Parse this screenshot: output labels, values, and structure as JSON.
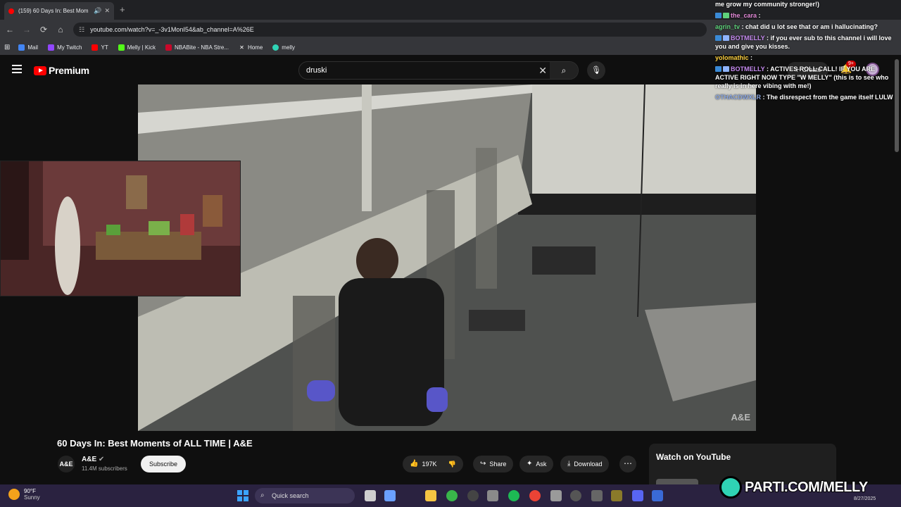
{
  "browser": {
    "tab_title": "(159) 60 Days In: Best Mom",
    "url": "youtube.com/watch?v=_-3v1MonI54&ab_channel=A%26E",
    "bookmarks": [
      "Mail",
      "My Twitch",
      "YT",
      "Melly | Kick",
      "NBABite - NBA Stre...",
      "Home",
      "melly"
    ]
  },
  "yt": {
    "logo_text": "Premium",
    "search_value": "druski",
    "create_label": "Create",
    "notif_count": "9+"
  },
  "video": {
    "watermark": "A&E",
    "title": "60 Days In: Best Moments of ALL TIME | A&E",
    "channel_name": "A&E",
    "channel_icon_text": "A&E",
    "subscribers": "11.4M subscribers",
    "subscribe_label": "Subscribe",
    "likes": "197K",
    "share_label": "Share",
    "ask_label": "Ask",
    "download_label": "Download",
    "watch_on_label": "Watch on YouTube"
  },
  "chat": [
    {
      "user": "",
      "text": "me grow my community stronger!)",
      "color": "#ffffff"
    },
    {
      "user": "the_cara",
      "text": " :",
      "color": "#e48ad8"
    },
    {
      "user": "agrin_tv",
      "text": " : chat did u lot see that or am i hallucinating?",
      "color": "#5fd17b"
    },
    {
      "user": "BOTMELLY",
      "text": " : if you ever sub to this channel i will love you and give you kisses.",
      "color": "#c68bf0"
    },
    {
      "user": "yolomathic",
      "text": " :",
      "color": "#ffd23f"
    },
    {
      "user": "BOTMELLY",
      "text": " : ACTIVES ROLL CALL! IF YOU ARE ACTIVE RIGHT NOW TYPE \"W MELLY\" (this is to see who really is in here vibing with me!)",
      "color": "#c68bf0"
    },
    {
      "user": "OTHACDWXLR",
      "text": " : The disrespect from the game itself LULW",
      "color": "#8aa6e0"
    }
  ],
  "taskbar": {
    "temp": "90°F",
    "condition": "Sunny",
    "search_label": "Quick search",
    "date": "8/27/2025"
  },
  "overlay": {
    "brand": "PARTI.COM/MELLY"
  }
}
